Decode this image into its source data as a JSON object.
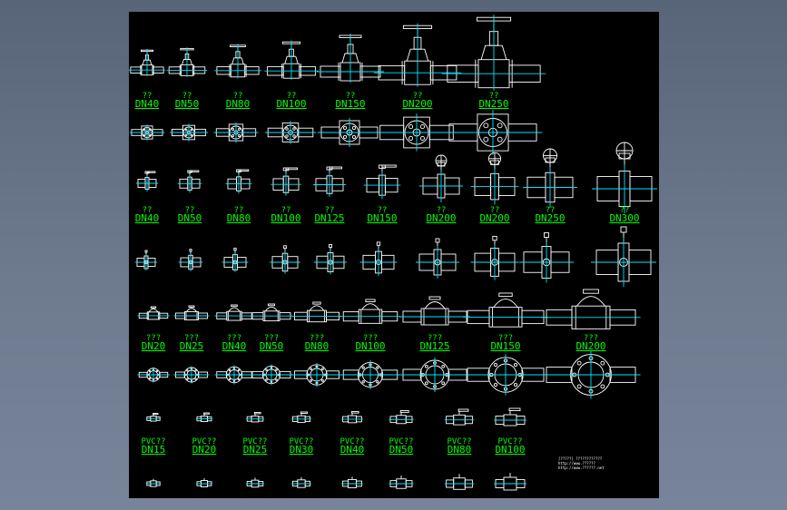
{
  "colors": {
    "background": "#6e7a8e",
    "canvas": "#000000",
    "label": "#00ff00",
    "centerline": "#00e5ff",
    "symbol": "#ffffff"
  },
  "rows": [
    {
      "symbol": "gate-valve-elevation",
      "items": [
        {
          "title": "??",
          "size": "DN40"
        },
        {
          "title": "??",
          "size": "DN50"
        },
        {
          "title": "??",
          "size": "DN80"
        },
        {
          "title": "??",
          "size": "DN100"
        },
        {
          "title": "??",
          "size": "DN150"
        },
        {
          "title": "??",
          "size": "DN200"
        },
        {
          "title": "??",
          "size": "DN250"
        }
      ]
    },
    {
      "symbol": "gate-valve-plan",
      "items": [
        {},
        {},
        {},
        {},
        {},
        {},
        {}
      ]
    },
    {
      "symbol": "butterfly-valve-elevation",
      "items": [
        {
          "title": "??",
          "size": "DN40"
        },
        {
          "title": "??",
          "size": "DN50"
        },
        {
          "title": "??",
          "size": "DN80"
        },
        {
          "title": "??",
          "size": "DN100"
        },
        {
          "title": "??",
          "size": "DN125"
        },
        {
          "title": "??",
          "size": "DN150"
        },
        {
          "title": "??",
          "size": "DN200"
        },
        {
          "title": "??",
          "size": "DN200"
        },
        {
          "title": "??",
          "size": "DN250"
        },
        {
          "title": "??",
          "size": "DN300"
        }
      ]
    },
    {
      "symbol": "butterfly-valve-plan",
      "items": [
        {},
        {},
        {},
        {},
        {},
        {},
        {},
        {},
        {},
        {}
      ]
    },
    {
      "symbol": "check-valve-elevation",
      "items": [
        {
          "title": "???",
          "size": "DN20"
        },
        {
          "title": "???",
          "size": "DN25"
        },
        {
          "title": "???",
          "size": "DN40"
        },
        {
          "title": "???",
          "size": "DN50"
        },
        {
          "title": "???",
          "size": "DN80"
        },
        {
          "title": "???",
          "size": "DN100"
        },
        {
          "title": "???",
          "size": "DN125"
        },
        {
          "title": "???",
          "size": "DN150"
        },
        {
          "title": "???",
          "size": "DN200"
        }
      ]
    },
    {
      "symbol": "check-valve-plan",
      "items": [
        {},
        {},
        {},
        {},
        {},
        {},
        {},
        {},
        {}
      ]
    },
    {
      "symbol": "pvc-ball-valve-elevation",
      "items": [
        {
          "title": "PVC??",
          "size": "DN15"
        },
        {
          "title": "PVC??",
          "size": "DN20"
        },
        {
          "title": "PVC??",
          "size": "DN25"
        },
        {
          "title": "PVC??",
          "size": "DN30"
        },
        {
          "title": "PVC??",
          "size": "DN40"
        },
        {
          "title": "PVC??",
          "size": "DN50"
        },
        {
          "title": "PVC??",
          "size": "DN80"
        },
        {
          "title": "PVC??",
          "size": "DN100"
        }
      ]
    },
    {
      "symbol": "pvc-ball-valve-plan",
      "items": [
        {},
        {},
        {},
        {},
        {},
        {},
        {},
        {}
      ]
    }
  ],
  "note": {
    "line1": "[?????]   ????????????",
    "line2": "http://www.??????",
    "line3": "http://www.??????.net"
  }
}
